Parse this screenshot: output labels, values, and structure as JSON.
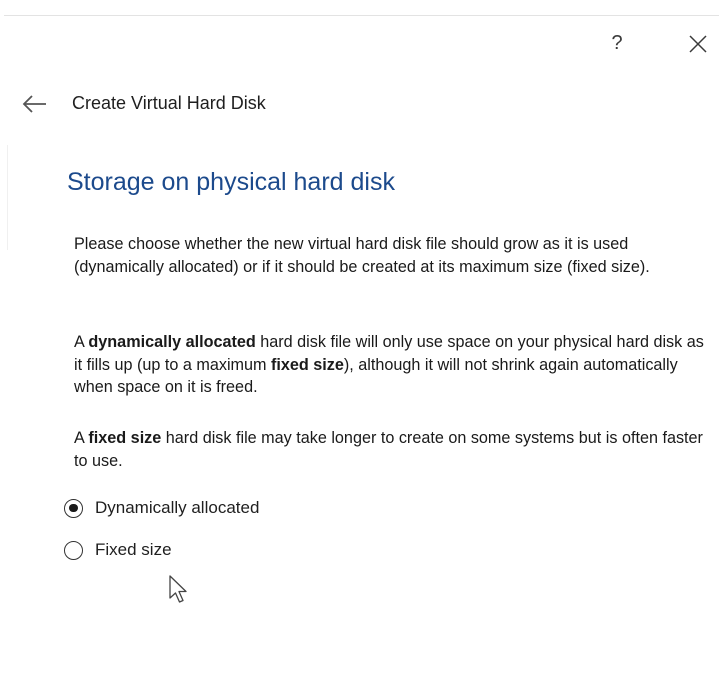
{
  "titlebar": {
    "help_label": "?",
    "close_icon": "close-icon"
  },
  "header": {
    "back_icon": "back-arrow-icon",
    "title": "Create Virtual Hard Disk"
  },
  "main": {
    "heading": "Storage on physical hard disk",
    "intro": "Please choose whether the new virtual hard disk file should grow as it is used (dynamically allocated) or if it should be created at its maximum size (fixed size).",
    "dynamic_para": {
      "pre": "A ",
      "bold1": "dynamically allocated",
      "mid": " hard disk file will only use space on your physical hard disk as it fills up (up to a maximum ",
      "bold2": "fixed size",
      "post": "), although it will not shrink again automatically when space on it is freed."
    },
    "fixed_para": {
      "pre": "A ",
      "bold": "fixed size",
      "post": " hard disk file may take longer to create on some systems but is often faster to use."
    },
    "options": [
      {
        "label": "Dynamically allocated",
        "selected": true
      },
      {
        "label": "Fixed size",
        "selected": false
      }
    ]
  },
  "colors": {
    "heading": "#1c4a8c",
    "text": "#1a1a1a"
  }
}
